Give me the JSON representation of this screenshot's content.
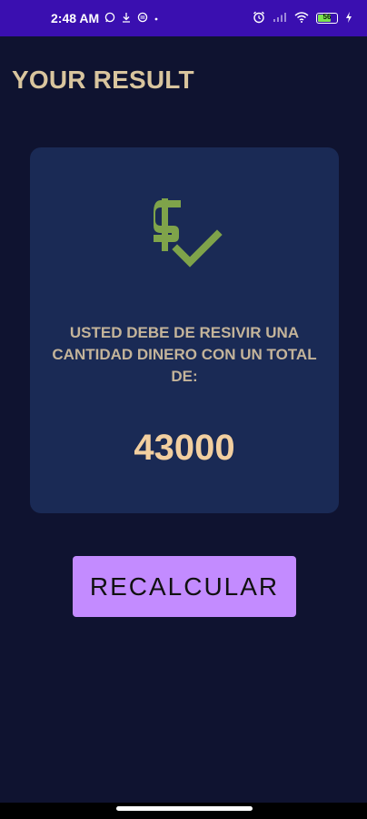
{
  "status_bar": {
    "time": "2:48 AM",
    "battery_level": "56"
  },
  "page": {
    "title": "YOUR RESULT"
  },
  "result": {
    "icon": "money-check-icon",
    "message": "USTED DEBE DE RESIVIR UNA CANTIDAD DINERO CON UN TOTAL DE:",
    "amount": "43000"
  },
  "actions": {
    "recalculate_label": "RECALCULAR"
  },
  "colors": {
    "status_bar": "#3a0fb0",
    "background": "#0f1330",
    "card": "#1a2a55",
    "title": "#d9c59e",
    "icon": "#7fa34a",
    "amount": "#f2cfa0",
    "button": "#c38bff"
  }
}
